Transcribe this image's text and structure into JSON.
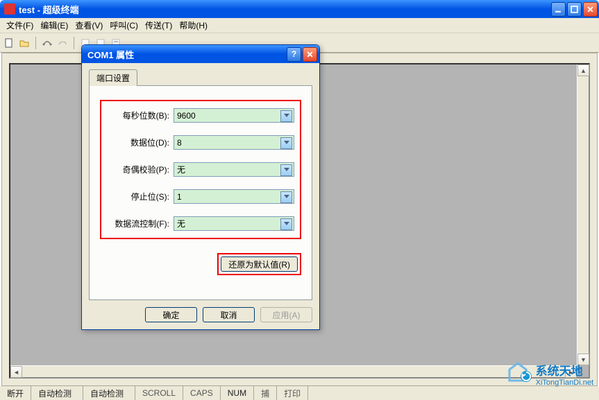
{
  "window": {
    "title": "test - 超级终端"
  },
  "menu": {
    "file": "文件(F)",
    "edit": "编辑(E)",
    "view": "查看(V)",
    "call": "呼叫(C)",
    "transfer": "传送(T)",
    "help": "帮助(H)"
  },
  "dialog": {
    "title": "COM1 属性",
    "tab": "端口设置",
    "fields": {
      "baud_label": "每秒位数(B):",
      "baud_value": "9600",
      "databits_label": "数据位(D):",
      "databits_value": "8",
      "parity_label": "奇偶校验(P):",
      "parity_value": "无",
      "stopbits_label": "停止位(S):",
      "stopbits_value": "1",
      "flowctrl_label": "数据流控制(F):",
      "flowctrl_value": "无"
    },
    "restore_btn": "还原为默认值(R)",
    "ok_btn": "确定",
    "cancel_btn": "取消",
    "apply_btn": "应用(A)"
  },
  "statusbar": {
    "conn": "断开",
    "auto1": "自动检测",
    "auto2": "自动检测",
    "scroll": "SCROLL",
    "caps": "CAPS",
    "num": "NUM",
    "capture": "捕",
    "print": "打印"
  },
  "watermark": {
    "name": "系统天地",
    "url": "XiTongTianDi.net"
  }
}
